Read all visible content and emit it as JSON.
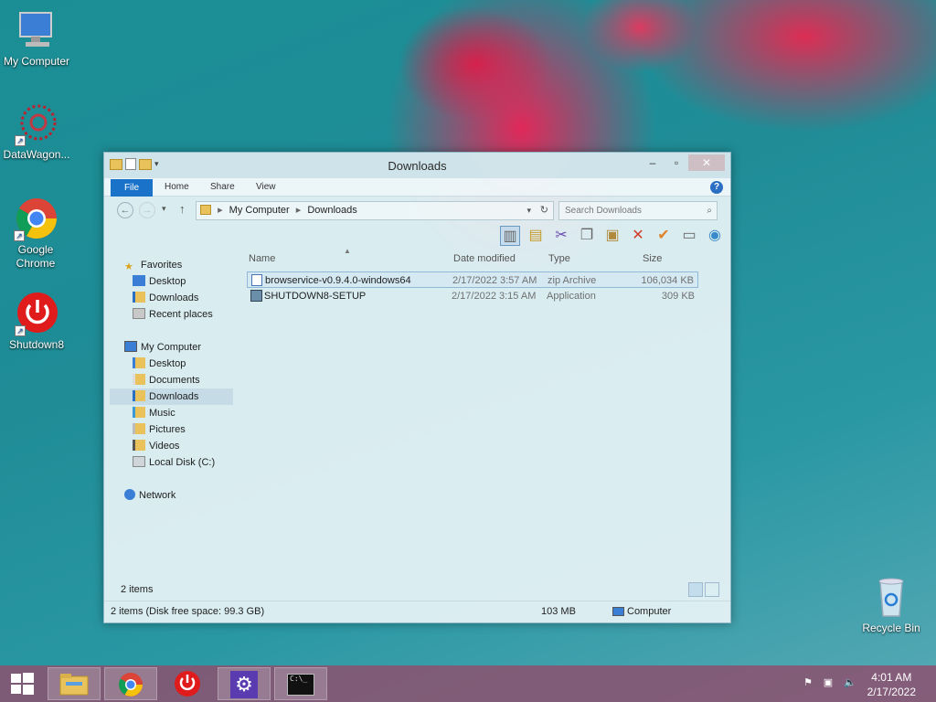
{
  "desktop": {
    "icons": [
      {
        "label": "My Computer"
      },
      {
        "label": "DataWagon..."
      },
      {
        "label": "Google Chrome"
      },
      {
        "label": "Shutdown8"
      },
      {
        "label": "Recycle Bin"
      }
    ]
  },
  "window": {
    "title": "Downloads",
    "ribbon_tabs": [
      "File",
      "Home",
      "Share",
      "View"
    ],
    "address": {
      "root": "My Computer",
      "current": "Downloads"
    },
    "search_placeholder": "Search Downloads",
    "columns": {
      "name": "Name",
      "date": "Date modified",
      "type": "Type",
      "size": "Size"
    },
    "files": [
      {
        "name": "browservice-v0.9.4.0-windows64",
        "date": "2/17/2022 3:57 AM",
        "type": "zip Archive",
        "size": "106,034 KB"
      },
      {
        "name": "SHUTDOWN8-SETUP",
        "date": "2/17/2022 3:15 AM",
        "type": "Application",
        "size": "309 KB"
      }
    ],
    "nav": {
      "favorites": "Favorites",
      "fav_items": [
        "Desktop",
        "Downloads",
        "Recent places"
      ],
      "computer": "My Computer",
      "comp_items": [
        "Desktop",
        "Documents",
        "Downloads",
        "Music",
        "Pictures",
        "Videos",
        "Local Disk (C:)"
      ],
      "network": "Network"
    },
    "item_count": "2 items",
    "status": {
      "left": "2 items (Disk free space: 99.3 GB)",
      "size": "103 MB",
      "location": "Computer"
    }
  },
  "taskbar": {
    "time": "4:01 AM",
    "date": "2/17/2022"
  },
  "colors": {
    "accent": "#1a73c9",
    "taskbar": "#8c506e"
  }
}
